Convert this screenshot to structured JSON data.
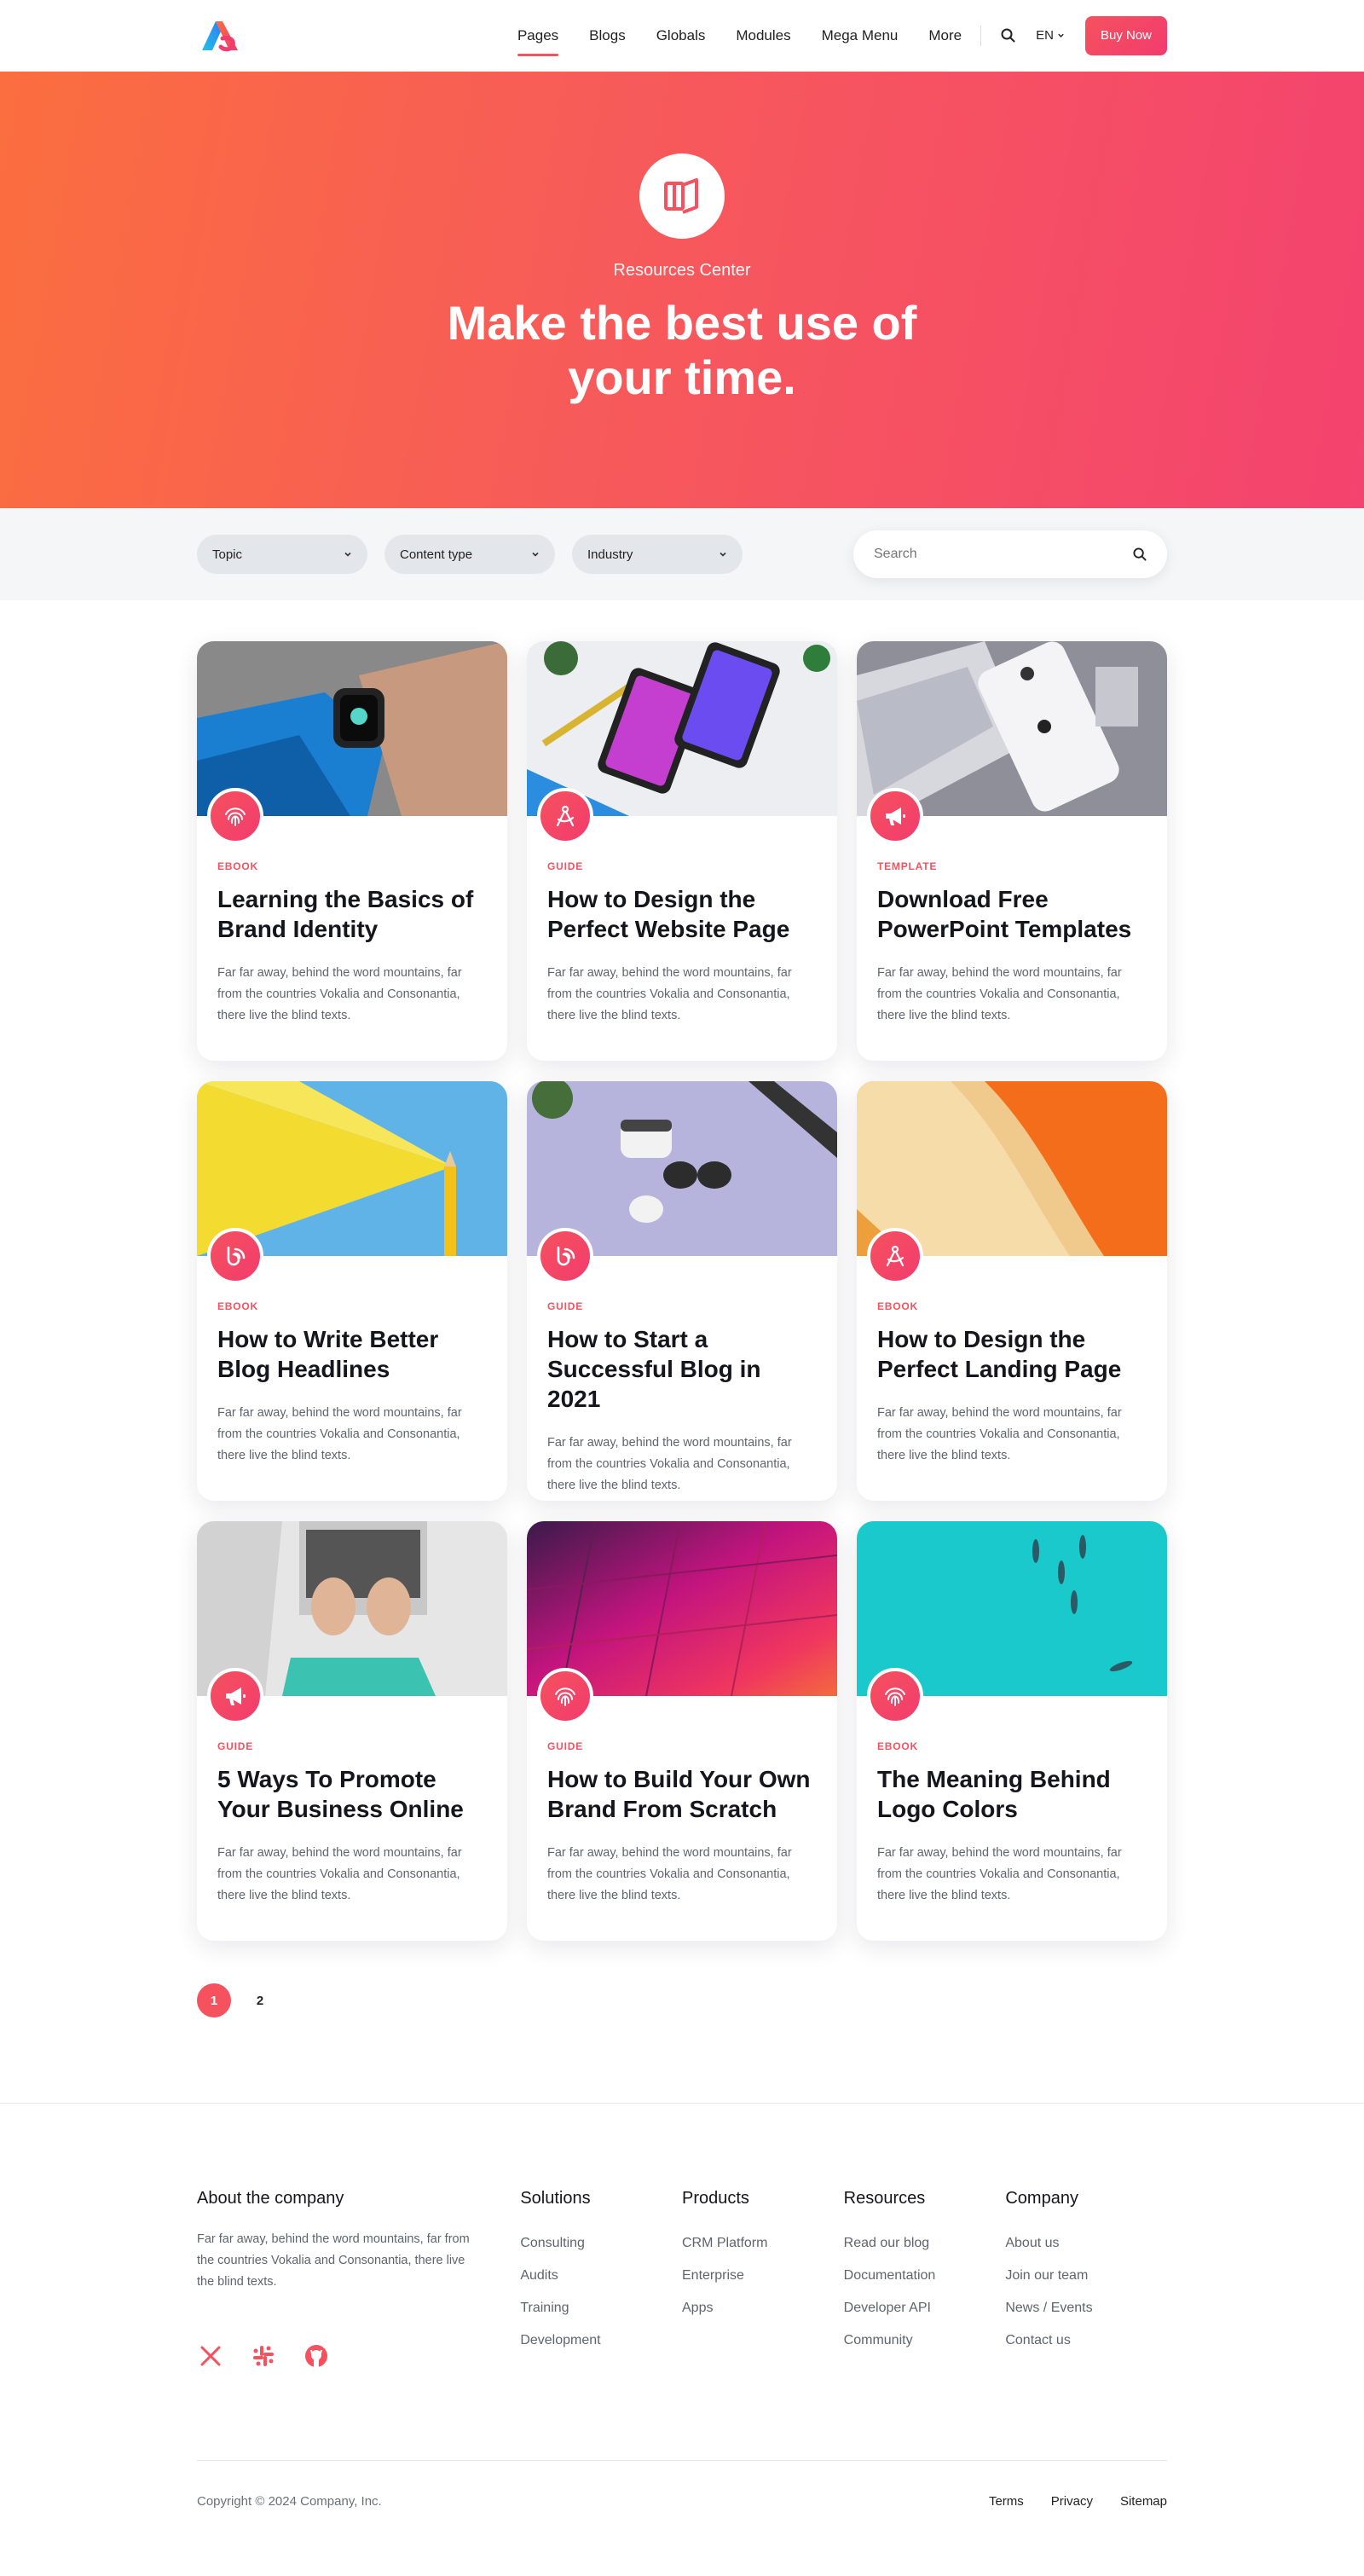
{
  "header": {
    "nav": [
      "Pages",
      "Blogs",
      "Globals",
      "Modules",
      "Mega Menu",
      "More"
    ],
    "lang": "EN",
    "buy_label": "Buy Now",
    "accent": "#f5515f"
  },
  "hero": {
    "eyebrow": "Resources Center",
    "title": "Make the best use of your time."
  },
  "filters": {
    "topic": "Topic",
    "content_type": "Content type",
    "industry": "Industry",
    "search_placeholder": "Search"
  },
  "cards": [
    {
      "category": "EBOOK",
      "title": "Learning the Basics of Brand Identity",
      "text": "Far far away, behind the word mountains, far from the countries Vokalia and Consonantia, there live the blind texts.",
      "icon": "fingerprint-icon"
    },
    {
      "category": "GUIDE",
      "title": "How to Design the Perfect Website Page",
      "text": "Far far away, behind the word mountains, far from the countries Vokalia and Consonantia, there live the blind texts.",
      "icon": "design-tool-icon"
    },
    {
      "category": "TEMPLATE",
      "title": "Download Free PowerPoint Templates",
      "text": "Far far away, behind the word mountains, far from the countries Vokalia and Consonantia, there live the blind texts.",
      "icon": "megaphone-icon"
    },
    {
      "category": "EBOOK",
      "title": "How to Write Better Blog Headlines",
      "text": "Far far away, behind the word mountains, far from the countries Vokalia and Consonantia, there live the blind texts.",
      "icon": "blog-icon"
    },
    {
      "category": "GUIDE",
      "title": "How to Start a Successful Blog in 2021",
      "text": "Far far away, behind the word mountains, far from the countries Vokalia and Consonantia, there live the blind texts.",
      "icon": "blog-icon"
    },
    {
      "category": "EBOOK",
      "title": "How to Design the Perfect Landing Page",
      "text": "Far far away, behind the word mountains, far from the countries Vokalia and Consonantia, there live the blind texts.",
      "icon": "design-tool-icon"
    },
    {
      "category": "GUIDE",
      "title": "5 Ways To Promote Your Business Online",
      "text": "Far far away, behind the word mountains, far from the countries Vokalia and Consonantia, there live the blind texts.",
      "icon": "megaphone-icon"
    },
    {
      "category": "GUIDE",
      "title": "How to Build Your Own Brand From Scratch",
      "text": "Far far away, behind the word mountains, far from the countries Vokalia and Consonantia, there live the blind texts.",
      "icon": "fingerprint-icon"
    },
    {
      "category": "EBOOK",
      "title": "The Meaning Behind Logo Colors",
      "text": "Far far away, behind the word mountains, far from the countries Vokalia and Consonantia, there live the blind texts.",
      "icon": "fingerprint-icon"
    }
  ],
  "pagination": [
    "1",
    "2"
  ],
  "footer": {
    "about_heading": "About the company",
    "about_text": "Far far away, behind the word mountains, far from the countries Vokalia and Consonantia, there live the blind texts.",
    "columns": [
      {
        "heading": "Solutions",
        "links": [
          "Consulting",
          "Audits",
          "Training",
          "Development"
        ]
      },
      {
        "heading": "Products",
        "links": [
          "CRM Platform",
          "Enterprise",
          "Apps"
        ]
      },
      {
        "heading": "Resources",
        "links": [
          "Read our blog",
          "Documentation",
          "Developer API",
          "Community"
        ]
      },
      {
        "heading": "Company",
        "links": [
          "About us",
          "Join our team",
          "News / Events",
          "Contact us"
        ]
      }
    ],
    "copyright": "Copyright © 2024 Company, Inc.",
    "bottom_links": [
      "Terms",
      "Privacy",
      "Sitemap"
    ]
  }
}
